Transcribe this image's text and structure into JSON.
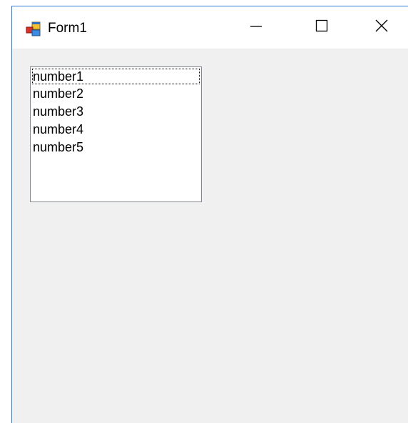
{
  "window": {
    "title": "Form1",
    "icon": "winforms-app-icon",
    "controls": {
      "minimize_icon": "minimize-icon",
      "maximize_icon": "maximize-icon",
      "close_icon": "close-icon"
    }
  },
  "listbox": {
    "items": [
      "number1",
      "number2",
      "number3",
      "number4",
      "number5"
    ],
    "focused_index": 0
  },
  "colors": {
    "window_border": "#2b7ad6",
    "client_background": "#f0f0f0",
    "titlebar_background": "#ffffff",
    "listbox_border": "#828790"
  }
}
